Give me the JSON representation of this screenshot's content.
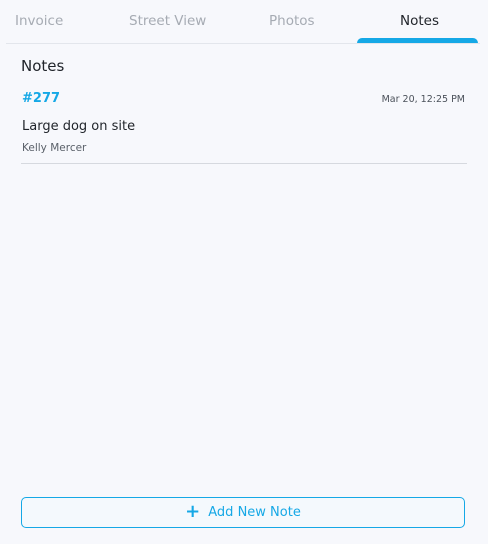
{
  "tabs": [
    {
      "label": "Invoice",
      "active": false
    },
    {
      "label": "Street View",
      "active": false
    },
    {
      "label": "Photos",
      "active": false
    },
    {
      "label": "Notes",
      "active": true
    }
  ],
  "notes_section": {
    "title": "Notes",
    "items": [
      {
        "id": "#277",
        "timestamp": "Mar 20, 12:25 PM",
        "text": "Large dog on site",
        "author": "Kelly Mercer"
      }
    ]
  },
  "add_note_button": {
    "icon": "plus-icon",
    "label": "Add New Note"
  },
  "colors": {
    "accent": "#15a8e6",
    "background": "#f7f8fc",
    "inactive_tab": "#a6abb3"
  }
}
